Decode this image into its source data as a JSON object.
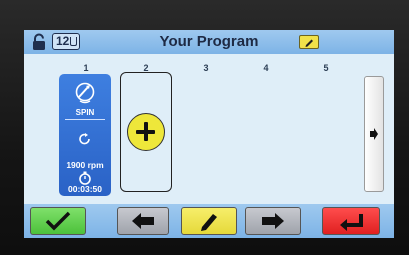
{
  "header": {
    "title": "Your Program",
    "device_number": "12",
    "locked": true
  },
  "steps": {
    "numbers": [
      "1",
      "2",
      "3",
      "4",
      "5"
    ]
  },
  "step1": {
    "mode": "SPIN",
    "speed": "1900 rpm",
    "time": "00:03:50"
  },
  "icons": {
    "lock": "lock-icon",
    "cup": "cup-icon",
    "edit_title": "pencil-icon",
    "spin": "spin-icon",
    "rotation": "rotation-icon",
    "timer": "timer-icon",
    "add": "plus-icon",
    "scroll": "right-arrow-icon",
    "ok": "checkmark-icon",
    "back": "left-arrow-icon",
    "edit": "pencil-icon",
    "forward": "right-arrow-icon",
    "return": "return-arrow-icon"
  },
  "colors": {
    "header_bg": "#8fbfea",
    "screen_bg": "#dfeef8",
    "step_card": "#3a77db",
    "ok_button": "#5fd24a",
    "nav_button": "#b3b6bd",
    "edit_button": "#efe255",
    "return_button": "#f23a3a",
    "add_button": "#eee73a"
  }
}
